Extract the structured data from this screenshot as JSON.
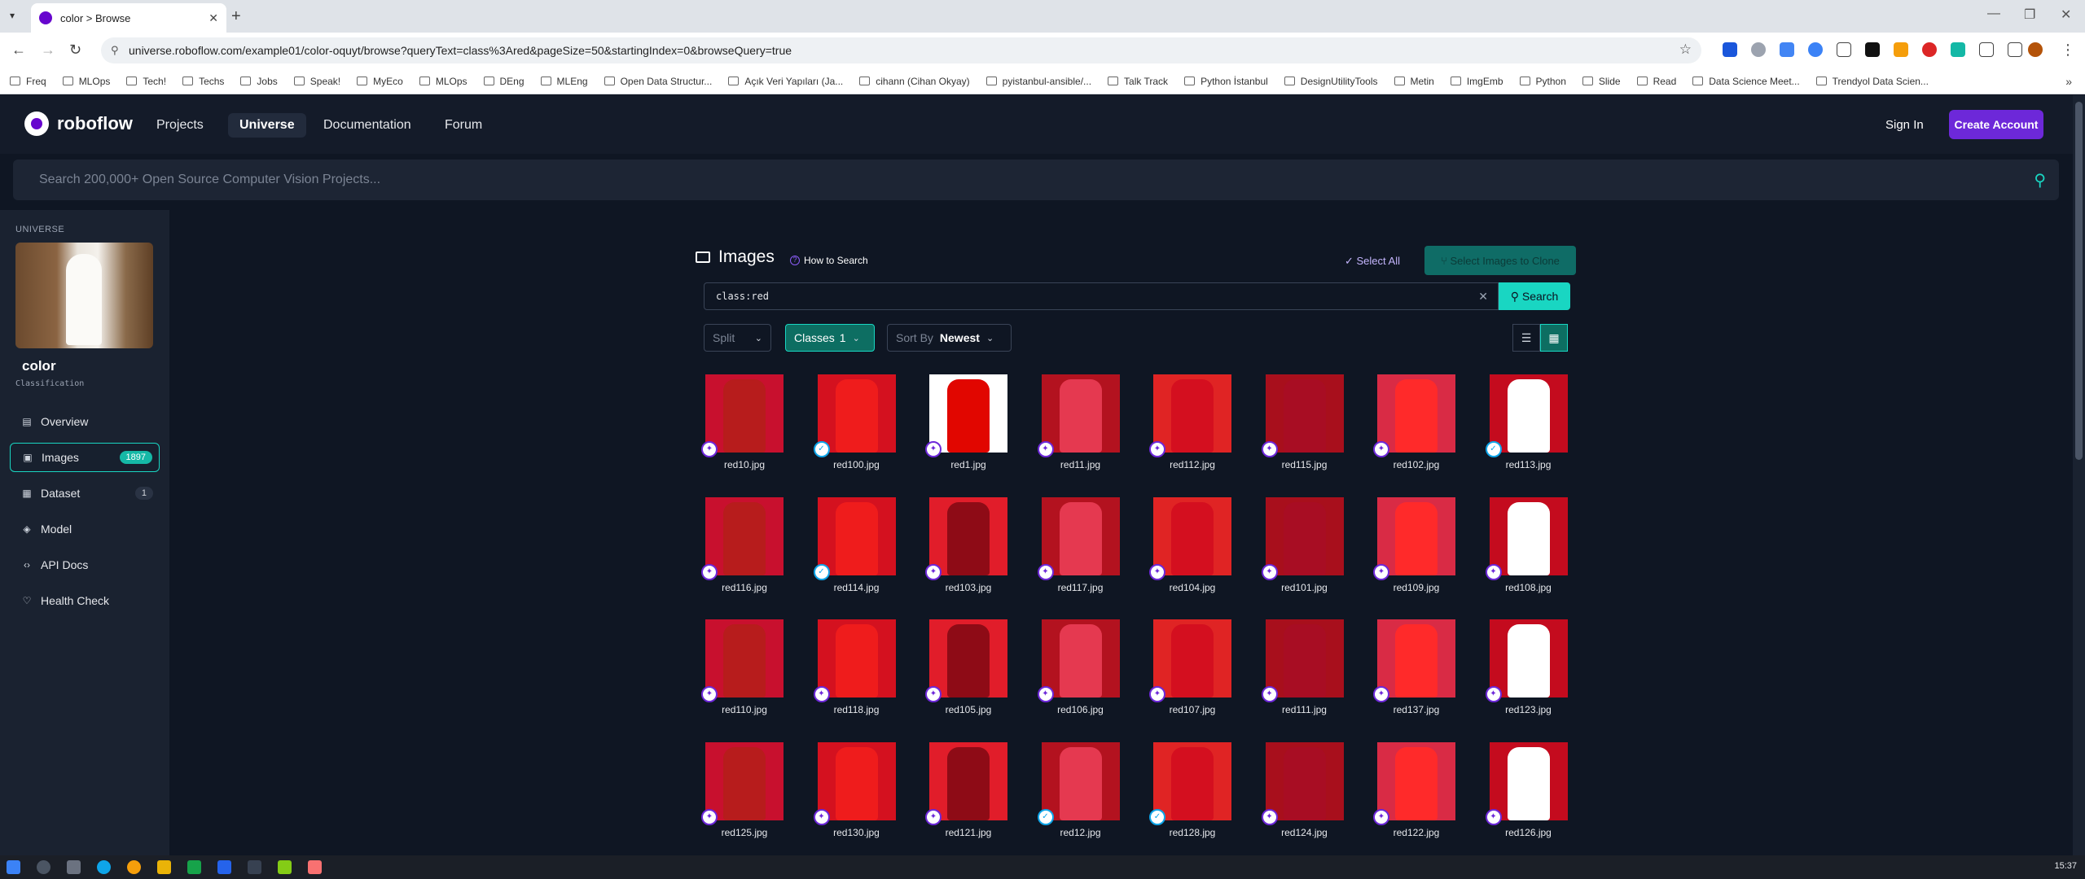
{
  "browser": {
    "tab_title": "color > Browse",
    "url": "universe.roboflow.com/example01/color-oquyt/browse?queryText=class%3Ared&pageSize=50&startingIndex=0&browseQuery=true",
    "bookmarks": [
      "Freq",
      "MLOps",
      "Tech!",
      "Techs",
      "Jobs",
      "Speak!",
      "MyEco",
      "MLOps",
      "DEng",
      "MLEng",
      "Open Data Structur...",
      "Açık Veri Yapıları (Ja...",
      "cihann (Cihan Okyay)",
      "pyistanbul-ansible/...",
      "Talk Track",
      "Python İstanbul",
      "DesignUtilityTools",
      "Metin",
      "ImgEmb",
      "Python",
      "Slide",
      "Read",
      "Data Science Meet...",
      "Trendyol Data Scien..."
    ]
  },
  "header": {
    "brand": "roboflow",
    "nav": [
      "Projects",
      "Universe",
      "Documentation",
      "Forum"
    ],
    "sign_in": "Sign In",
    "create_account": "Create Account",
    "search_placeholder": "Search 200,000+ Open Source Computer Vision Projects..."
  },
  "sidebar": {
    "kicker": "UNIVERSE",
    "project_name": "color",
    "project_type": "Classification",
    "items": [
      {
        "label": "Overview",
        "icon": "document-icon"
      },
      {
        "label": "Images",
        "icon": "image-icon",
        "badge": "1897"
      },
      {
        "label": "Dataset",
        "icon": "dataset-icon",
        "badge": "1"
      },
      {
        "label": "Model",
        "icon": "model-icon"
      },
      {
        "label": "API Docs",
        "icon": "code-icon"
      },
      {
        "label": "Health Check",
        "icon": "health-icon"
      }
    ]
  },
  "main": {
    "title": "Images",
    "how_to": "How to Search",
    "select_all": "Select All",
    "clone_label": "Select Images to Clone",
    "query": "class:red",
    "search_button": "Search",
    "split_label": "Split",
    "classes_label": "Classes",
    "classes_count": "1",
    "sort_label": "Sort By",
    "sort_value": "Newest"
  },
  "images": [
    {
      "name": "red10.jpg",
      "mark": "person"
    },
    {
      "name": "red100.jpg",
      "mark": "ok"
    },
    {
      "name": "red1.jpg",
      "mark": "person"
    },
    {
      "name": "red11.jpg",
      "mark": "person"
    },
    {
      "name": "red112.jpg",
      "mark": "person"
    },
    {
      "name": "red115.jpg",
      "mark": "person"
    },
    {
      "name": "red102.jpg",
      "mark": "person"
    },
    {
      "name": "red113.jpg",
      "mark": "ok"
    },
    {
      "name": "red116.jpg",
      "mark": "person"
    },
    {
      "name": "red114.jpg",
      "mark": "ok"
    },
    {
      "name": "red103.jpg",
      "mark": "person"
    },
    {
      "name": "red117.jpg",
      "mark": "person"
    },
    {
      "name": "red104.jpg",
      "mark": "person"
    },
    {
      "name": "red101.jpg",
      "mark": "person"
    },
    {
      "name": "red109.jpg",
      "mark": "person"
    },
    {
      "name": "red108.jpg",
      "mark": "person"
    },
    {
      "name": "red110.jpg",
      "mark": "person"
    },
    {
      "name": "red118.jpg",
      "mark": "person"
    },
    {
      "name": "red105.jpg",
      "mark": "person"
    },
    {
      "name": "red106.jpg",
      "mark": "person"
    },
    {
      "name": "red107.jpg",
      "mark": "person"
    },
    {
      "name": "red111.jpg",
      "mark": "person"
    },
    {
      "name": "red137.jpg",
      "mark": "person"
    },
    {
      "name": "red123.jpg",
      "mark": "person"
    },
    {
      "name": "red125.jpg",
      "mark": "person"
    },
    {
      "name": "red130.jpg",
      "mark": "person"
    },
    {
      "name": "red121.jpg",
      "mark": "person"
    },
    {
      "name": "red12.jpg",
      "mark": "ok"
    },
    {
      "name": "red128.jpg",
      "mark": "ok"
    },
    {
      "name": "red124.jpg",
      "mark": "person"
    },
    {
      "name": "red122.jpg",
      "mark": "person"
    },
    {
      "name": "red126.jpg",
      "mark": "person"
    }
  ],
  "colors": {
    "accent_teal": "#19d6c2",
    "brand_purple": "#6d28d9",
    "page_bg": "#0f1623"
  },
  "taskbar": {
    "clock": "15:37"
  }
}
